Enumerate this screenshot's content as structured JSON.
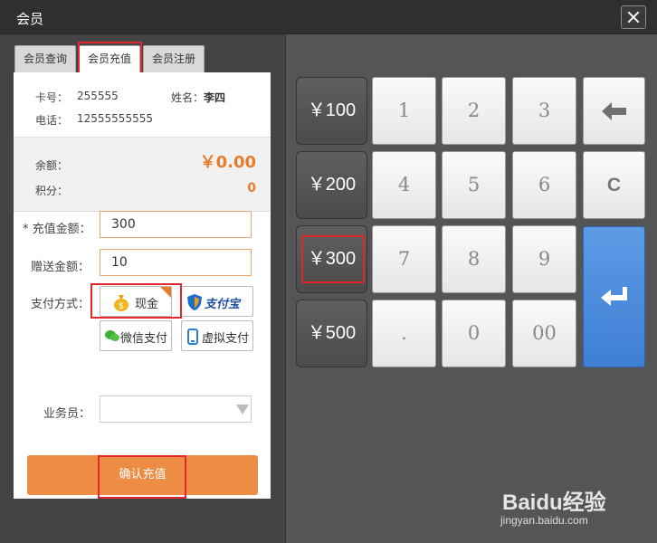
{
  "window": {
    "title": "会员"
  },
  "tabs": [
    {
      "label": "会员查询",
      "active": false
    },
    {
      "label": "会员充值",
      "active": true
    },
    {
      "label": "会员注册",
      "active": false
    }
  ],
  "member": {
    "card_label": "卡号：",
    "card_no": "255555",
    "name_label": "姓名：",
    "name": "李四",
    "phone_label": "电话：",
    "phone": "12555555555"
  },
  "balance": {
    "balance_label": "余额：",
    "balance_value": "￥0.00",
    "points_label": "积分：",
    "points_value": "0"
  },
  "form": {
    "amount_label": "* 充值金额：",
    "amount_value": "300",
    "gift_label": "赠送金额：",
    "gift_value": "10",
    "payment_label": "支付方式：",
    "payment_methods": [
      "现金",
      "支付宝",
      "微信支付",
      "虚拟支付"
    ],
    "selected_payment": "现金",
    "staff_label": "业务员：",
    "staff_value": "",
    "confirm_label": "确认充值"
  },
  "keypad": {
    "amounts": [
      "￥100",
      "￥200",
      "￥300",
      "￥500"
    ],
    "keys": [
      "1",
      "2",
      "3",
      "4",
      "5",
      "6",
      "7",
      "8",
      "9",
      ".",
      "0",
      "00"
    ],
    "clear_label": "C"
  },
  "watermark": {
    "main": "Baidu经验",
    "sub": "jingyan.baidu.com"
  },
  "colors": {
    "accent": "#ec8c45",
    "enter_blue": "#4a8ad9",
    "highlight_red": "#e1262d"
  }
}
